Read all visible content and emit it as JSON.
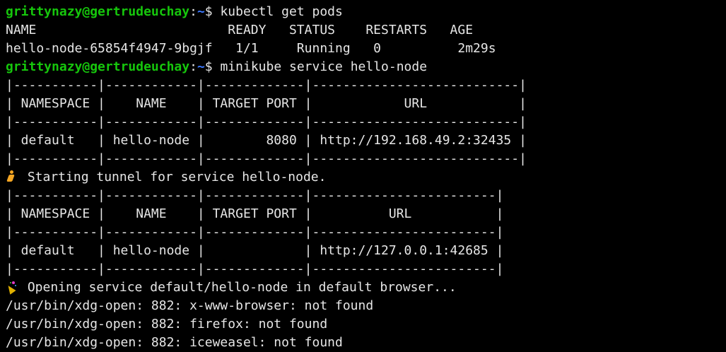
{
  "terminal": {
    "colors": {
      "background": "#000000",
      "foreground": "#e6e6e6",
      "prompt_user": "#16c60c",
      "prompt_path": "#3b78ff"
    },
    "lines": [
      {
        "type": "prompt",
        "user": "grittynazy@gertrudeuchay",
        "sep": ":",
        "path": "~",
        "sym": "$ ",
        "command": "kubectl get pods"
      },
      {
        "type": "text",
        "text": "NAME                         READY   STATUS    RESTARTS   AGE"
      },
      {
        "type": "text",
        "text": "hello-node-65854f4947-9bgjf   1/1     Running   0          2m29s"
      },
      {
        "type": "prompt",
        "user": "grittynazy@gertrudeuchay",
        "sep": ":",
        "path": "~",
        "sym": "$ ",
        "command": "minikube service hello-node"
      },
      {
        "type": "text",
        "text": "|-----------|------------|-------------|---------------------------|"
      },
      {
        "type": "text",
        "text": "| NAMESPACE |    NAME    | TARGET PORT |            URL            |"
      },
      {
        "type": "text",
        "text": "|-----------|------------|-------------|---------------------------|"
      },
      {
        "type": "text",
        "text": "| default   | hello-node |        8080 | http://192.168.49.2:32435 |"
      },
      {
        "type": "text",
        "text": "|-----------|------------|-------------|---------------------------|"
      },
      {
        "type": "emoji",
        "icon": "runner-icon",
        "text": " Starting tunnel for service hello-node."
      },
      {
        "type": "text",
        "text": "|-----------|------------|-------------|------------------------|"
      },
      {
        "type": "text",
        "text": "| NAMESPACE |    NAME    | TARGET PORT |          URL           |"
      },
      {
        "type": "text",
        "text": "|-----------|------------|-------------|------------------------|"
      },
      {
        "type": "text",
        "text": "| default   | hello-node |             | http://127.0.0.1:42685 |"
      },
      {
        "type": "text",
        "text": "|-----------|------------|-------------|------------------------|"
      },
      {
        "type": "emoji",
        "icon": "party-popper-icon",
        "text": " Opening service default/hello-node in default browser..."
      },
      {
        "type": "text",
        "text": "/usr/bin/xdg-open: 882: x-www-browser: not found"
      },
      {
        "type": "text",
        "text": "/usr/bin/xdg-open: 882: firefox: not found"
      },
      {
        "type": "text",
        "text": "/usr/bin/xdg-open: 882: iceweasel: not found"
      }
    ]
  }
}
